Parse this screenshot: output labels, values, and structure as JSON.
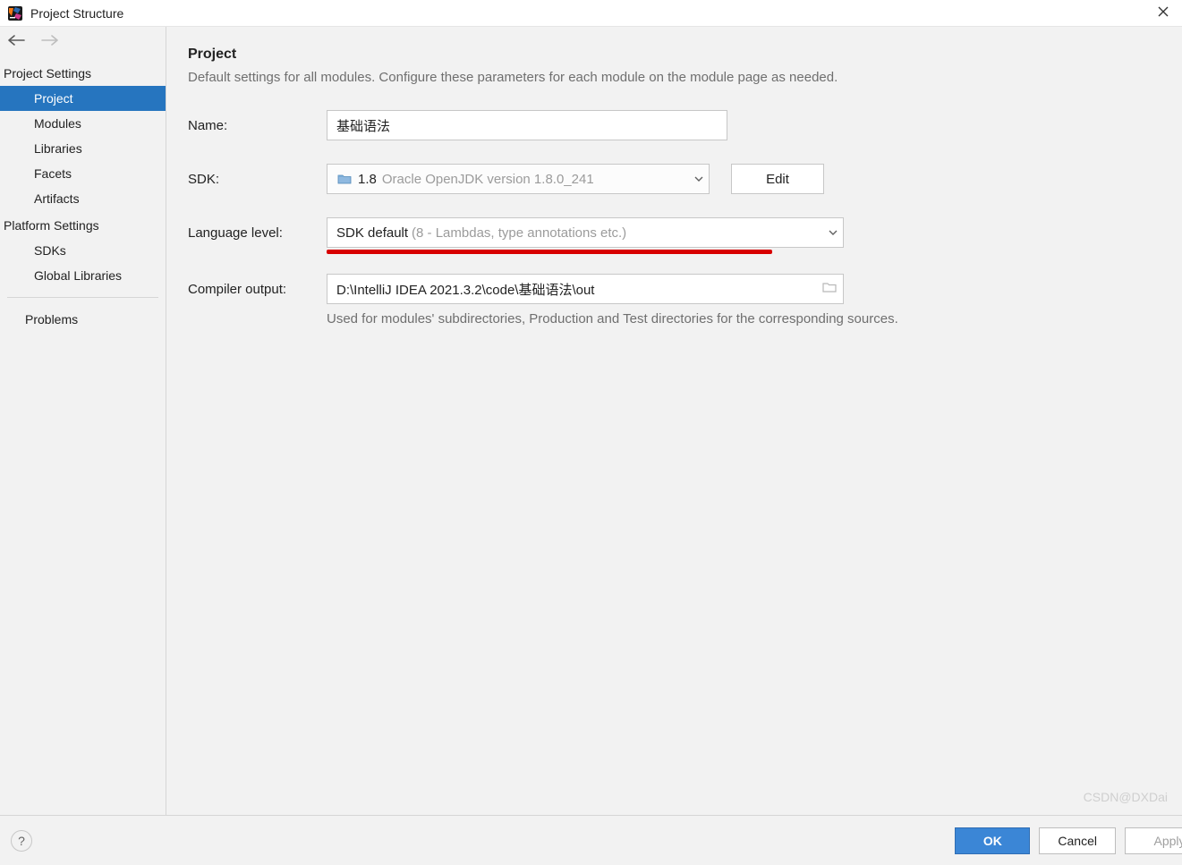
{
  "window": {
    "title": "Project Structure"
  },
  "sidebar": {
    "sections": {
      "projectSettings": {
        "header": "Project Settings",
        "items": [
          "Project",
          "Modules",
          "Libraries",
          "Facets",
          "Artifacts"
        ]
      },
      "platformSettings": {
        "header": "Platform Settings",
        "items": [
          "SDKs",
          "Global Libraries"
        ]
      },
      "problems": "Problems"
    }
  },
  "main": {
    "heading": "Project",
    "subheading": "Default settings for all modules. Configure these parameters for each module on the module page as needed.",
    "labels": {
      "name": "Name:",
      "sdk": "SDK:",
      "language": "Language level:",
      "compiler": "Compiler output:"
    },
    "name_value": "基础语法",
    "sdk_value": "1.8",
    "sdk_detail": "Oracle OpenJDK version 1.8.0_241",
    "edit_button": "Edit",
    "lang_value": "SDK default",
    "lang_detail": "(8 - Lambdas, type annotations etc.)",
    "compiler_path": "D:\\IntelliJ IDEA 2021.3.2\\code\\基础语法\\out",
    "compiler_hint": "Used for modules' subdirectories, Production and Test directories for the corresponding sources."
  },
  "footer": {
    "ok": "OK",
    "cancel": "Cancel",
    "apply": "Apply"
  },
  "watermark": "CSDN@DXDai"
}
